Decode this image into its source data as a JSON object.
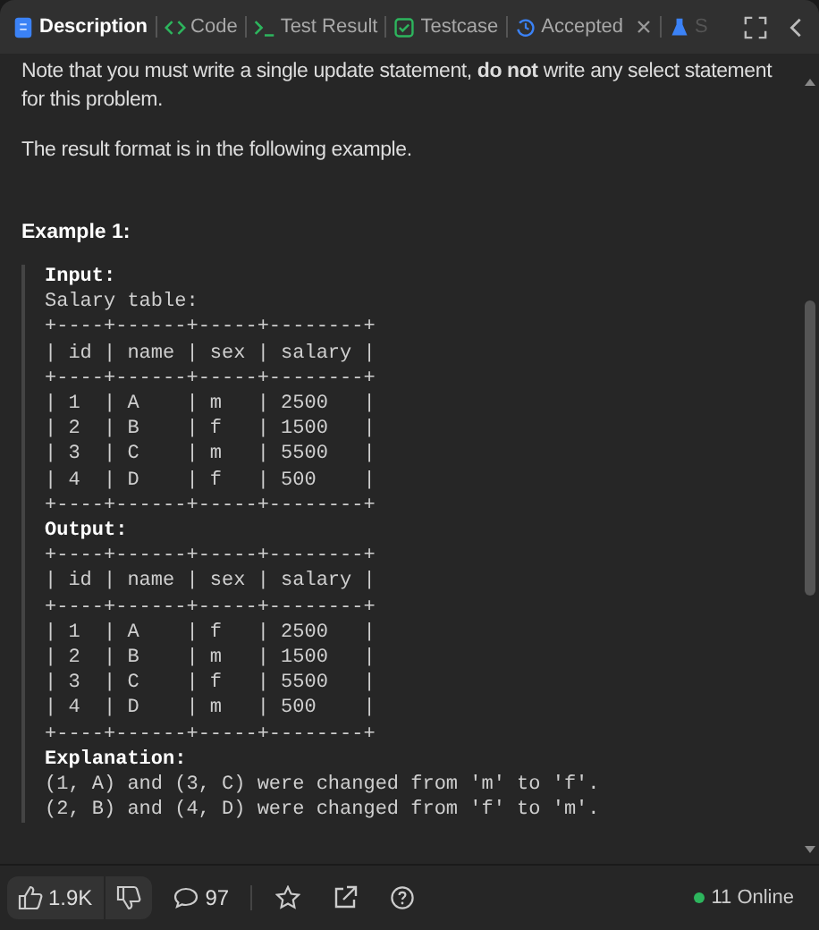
{
  "tabs": [
    {
      "label": "Description",
      "selected": true,
      "closable": false
    },
    {
      "label": "Code",
      "selected": false,
      "closable": false
    },
    {
      "label": "Test Result",
      "selected": false,
      "closable": false
    },
    {
      "label": "Testcase",
      "selected": false,
      "closable": false
    },
    {
      "label": "Accepted",
      "selected": false,
      "closable": true
    },
    {
      "label": "S",
      "selected": false,
      "closable": false
    }
  ],
  "description": {
    "paragraphs": [
      "Note that you must write a single update statement, **do not** write any select statement for this problem.",
      "The result format is in the following example."
    ],
    "example_title": "Example 1:",
    "example_lines": [
      {
        "kind": "label",
        "text": "Input:"
      },
      {
        "kind": "code",
        "text": "Salary table:"
      },
      {
        "kind": "code",
        "text": "+----+------+-----+--------+"
      },
      {
        "kind": "code",
        "text": "| id | name | sex | salary |"
      },
      {
        "kind": "code",
        "text": "+----+------+-----+--------+"
      },
      {
        "kind": "code",
        "text": "| 1  | A    | m   | 2500   |"
      },
      {
        "kind": "code",
        "text": "| 2  | B    | f   | 1500   |"
      },
      {
        "kind": "code",
        "text": "| 3  | C    | m   | 5500   |"
      },
      {
        "kind": "code",
        "text": "| 4  | D    | f   | 500    |"
      },
      {
        "kind": "code",
        "text": "+----+------+-----+--------+"
      },
      {
        "kind": "label",
        "text": "Output:"
      },
      {
        "kind": "code",
        "text": "+----+------+-----+--------+"
      },
      {
        "kind": "code",
        "text": "| id | name | sex | salary |"
      },
      {
        "kind": "code",
        "text": "+----+------+-----+--------+"
      },
      {
        "kind": "code",
        "text": "| 1  | A    | f   | 2500   |"
      },
      {
        "kind": "code",
        "text": "| 2  | B    | m   | 1500   |"
      },
      {
        "kind": "code",
        "text": "| 3  | C    | f   | 5500   |"
      },
      {
        "kind": "code",
        "text": "| 4  | D    | m   | 500    |"
      },
      {
        "kind": "code",
        "text": "+----+------+-----+--------+"
      },
      {
        "kind": "label",
        "text": "Explanation:"
      },
      {
        "kind": "code",
        "text": "(1, A) and (3, C) were changed from 'm' to 'f'."
      },
      {
        "kind": "code",
        "text": "(2, B) and (4, D) were changed from 'f' to 'm'."
      }
    ]
  },
  "footer": {
    "likes": "1.9K",
    "comments": "97",
    "online": "11 Online"
  }
}
